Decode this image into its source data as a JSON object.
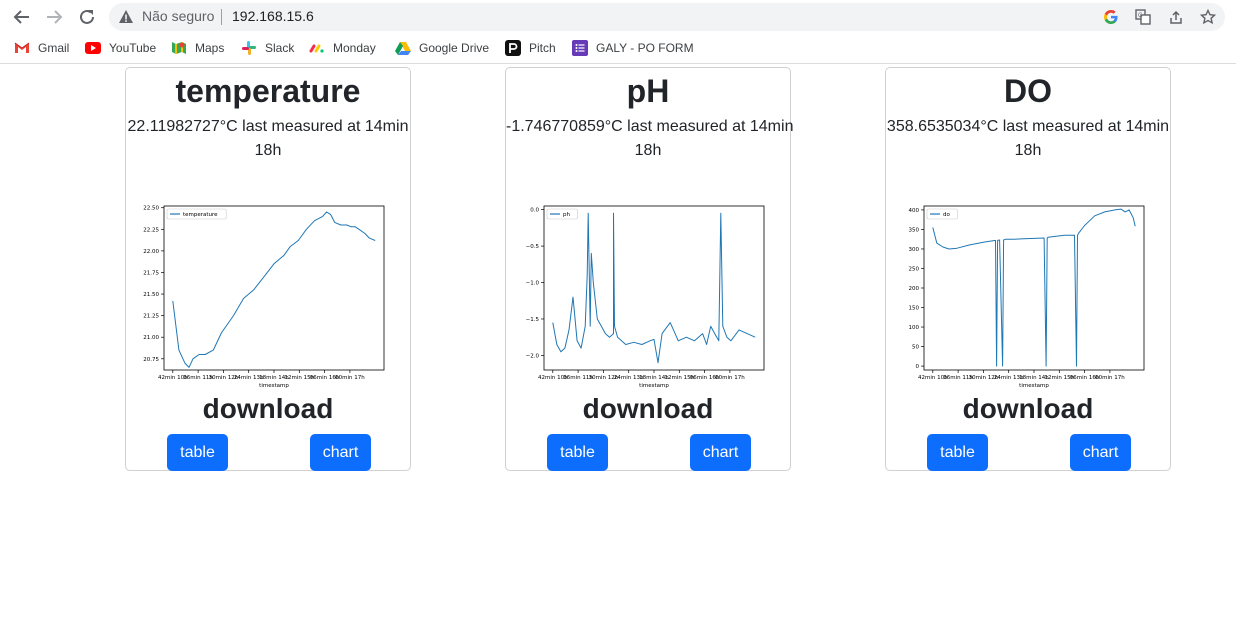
{
  "browser": {
    "security_label": "Não seguro",
    "url": "192.168.15.6"
  },
  "bookmarks": [
    {
      "label": "Gmail",
      "icon": "gmail-icon"
    },
    {
      "label": "YouTube",
      "icon": "youtube-icon"
    },
    {
      "label": "Maps",
      "icon": "maps-icon"
    },
    {
      "label": "Slack",
      "icon": "slack-icon"
    },
    {
      "label": "Monday",
      "icon": "monday-icon"
    },
    {
      "label": "Google Drive",
      "icon": "google-drive-icon"
    },
    {
      "label": "Pitch",
      "icon": "pitch-icon"
    },
    {
      "label": "GALY - PO FORM",
      "icon": "google-forms-icon"
    }
  ],
  "colors": {
    "button": "#0d6efd",
    "line": "#1f77b4"
  },
  "cards": [
    {
      "title": "temperature",
      "reading_line1": "22.11982727°C last measured at 14min",
      "reading_line2": "18h",
      "download_label": "download",
      "table_label": "table",
      "chart_label": "chart"
    },
    {
      "title": "pH",
      "reading_line1": "-1.746770859°C last measured at 14min",
      "reading_line2": "18h",
      "download_label": "download",
      "table_label": "table",
      "chart_label": "chart"
    },
    {
      "title": "DO",
      "reading_line1": "358.6535034°C last measured at 14min",
      "reading_line2": "18h",
      "download_label": "download",
      "table_label": "table",
      "chart_label": "chart"
    }
  ],
  "chart_data": [
    {
      "type": "line",
      "title": "",
      "xlabel": "timestamp",
      "ylabel": "",
      "legend": "top-left",
      "x_tick_labels": [
        "42min 10h",
        "36min 11h",
        "30min 12h",
        "24min 13h",
        "18min 14h",
        "12min 15h",
        "06min 16h",
        "00min 17h"
      ],
      "ylim": [
        20.62,
        22.52
      ],
      "y_ticks": [
        20.75,
        21.0,
        21.25,
        21.5,
        21.75,
        22.0,
        22.25,
        22.5
      ],
      "y_tick_labels": [
        "20.75",
        "21.00",
        "21.25",
        "21.50",
        "21.75",
        "22.00",
        "22.25",
        "22.50"
      ],
      "series": [
        {
          "name": "temperature",
          "x": [
            0,
            0.03,
            0.06,
            0.08,
            0.1,
            0.13,
            0.16,
            0.2,
            0.24,
            0.3,
            0.35,
            0.4,
            0.45,
            0.5,
            0.55,
            0.58,
            0.62,
            0.66,
            0.7,
            0.74,
            0.76,
            0.78,
            0.8,
            0.83,
            0.86,
            0.88,
            0.9,
            0.92,
            0.95,
            0.97,
            1.0
          ],
          "y": [
            21.42,
            20.85,
            20.7,
            20.65,
            20.75,
            20.8,
            20.8,
            20.85,
            21.05,
            21.25,
            21.45,
            21.55,
            21.7,
            21.85,
            21.95,
            22.05,
            22.12,
            22.25,
            22.35,
            22.4,
            22.45,
            22.42,
            22.33,
            22.3,
            22.3,
            22.28,
            22.28,
            22.25,
            22.2,
            22.15,
            22.12
          ]
        }
      ]
    },
    {
      "type": "line",
      "title": "",
      "xlabel": "timestamp",
      "ylabel": "",
      "legend": "top-left",
      "x_tick_labels": [
        "42min 10h",
        "36min 11h",
        "30min 12h",
        "24min 13h",
        "18min 14h",
        "12min 15h",
        "06min 16h",
        "00min 17h"
      ],
      "ylim": [
        -2.2,
        0.05
      ],
      "y_ticks": [
        -2.0,
        -1.5,
        -1.0,
        -0.5,
        0.0
      ],
      "y_tick_labels": [
        "−2.0",
        "−1.5",
        "−1.0",
        "−0.5",
        "0.0"
      ],
      "series": [
        {
          "name": "ph",
          "x": [
            0,
            0.02,
            0.04,
            0.06,
            0.08,
            0.1,
            0.12,
            0.14,
            0.16,
            0.17,
            0.175,
            0.185,
            0.19,
            0.2,
            0.22,
            0.24,
            0.26,
            0.28,
            0.3,
            0.3,
            0.305,
            0.32,
            0.34,
            0.36,
            0.4,
            0.44,
            0.48,
            0.5,
            0.52,
            0.54,
            0.58,
            0.62,
            0.66,
            0.7,
            0.74,
            0.76,
            0.78,
            0.8,
            0.82,
            0.83,
            0.84,
            0.86,
            0.88,
            0.92,
            0.96,
            1.0
          ],
          "y": [
            -1.55,
            -1.85,
            -1.95,
            -1.9,
            -1.65,
            -1.2,
            -1.8,
            -1.9,
            -1.6,
            -0.9,
            -0.05,
            -1.6,
            -0.6,
            -1.0,
            -1.5,
            -1.6,
            -1.7,
            -1.75,
            -1.7,
            -0.05,
            -1.6,
            -1.75,
            -1.8,
            -1.85,
            -1.82,
            -1.85,
            -1.8,
            -1.78,
            -2.1,
            -1.7,
            -1.55,
            -1.8,
            -1.75,
            -1.8,
            -1.7,
            -1.85,
            -1.6,
            -1.7,
            -1.8,
            -0.05,
            -1.6,
            -1.75,
            -1.8,
            -1.65,
            -1.7,
            -1.75
          ]
        }
      ]
    },
    {
      "type": "line",
      "title": "",
      "xlabel": "timestamp",
      "ylabel": "",
      "legend": "top-left",
      "x_tick_labels": [
        "42min 10h",
        "36min 11h",
        "30min 12h",
        "24min 13h",
        "18min 14h",
        "12min 15h",
        "06min 16h",
        "00min 17h"
      ],
      "ylim": [
        -10,
        410
      ],
      "y_ticks": [
        0,
        50,
        100,
        150,
        200,
        250,
        300,
        350,
        400
      ],
      "y_tick_labels": [
        "0",
        "50",
        "100",
        "150",
        "200",
        "250",
        "300",
        "350",
        "400"
      ],
      "series": [
        {
          "name": "do",
          "x": [
            0,
            0.02,
            0.05,
            0.08,
            0.12,
            0.18,
            0.26,
            0.31,
            0.315,
            0.32,
            0.33,
            0.345,
            0.35,
            0.36,
            0.4,
            0.45,
            0.5,
            0.55,
            0.56,
            0.565,
            0.57,
            0.6,
            0.65,
            0.7,
            0.71,
            0.715,
            0.72,
            0.75,
            0.78,
            0.8,
            0.85,
            0.9,
            0.93,
            0.95,
            0.97,
            0.99,
            1.0
          ],
          "y": [
            355,
            315,
            305,
            300,
            302,
            310,
            318,
            322,
            0,
            322,
            323,
            0,
            323,
            325,
            325,
            326,
            327,
            328,
            0,
            328,
            330,
            332,
            335,
            335,
            0,
            335,
            340,
            360,
            375,
            385,
            395,
            400,
            402,
            395,
            400,
            380,
            358
          ]
        }
      ]
    }
  ]
}
